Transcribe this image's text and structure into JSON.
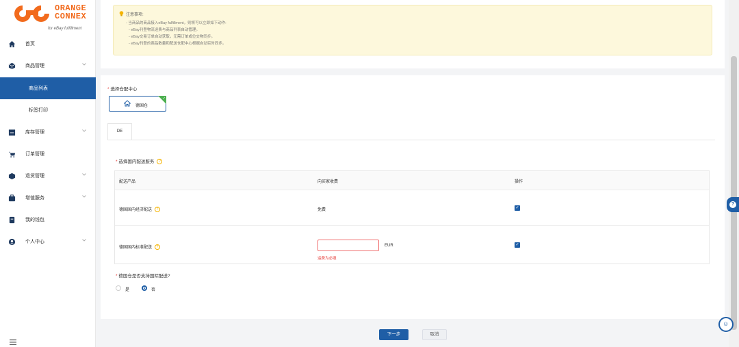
{
  "brand": {
    "logo_line1": "ORANGE",
    "logo_line2": "CONNEX",
    "tagline": "for eBay fulfillment",
    "accent": "#f26b1d"
  },
  "sidebar": {
    "items": [
      {
        "label": "首页",
        "icon": "home-icon"
      },
      {
        "label": "商品管理",
        "icon": "box-icon"
      },
      {
        "label": "商品列表",
        "icon": "",
        "active": true
      },
      {
        "label": "标签打印",
        "icon": ""
      },
      {
        "label": "库存管理",
        "icon": "warehouse-icon"
      },
      {
        "label": "订单管理",
        "icon": "cart-icon"
      },
      {
        "label": "退货管理",
        "icon": "return-icon"
      },
      {
        "label": "增值服务",
        "icon": "service-icon"
      },
      {
        "label": "我的钱包",
        "icon": "wallet-icon"
      },
      {
        "label": "个人中心",
        "icon": "user-icon"
      }
    ],
    "active_color": "#1f5ea6"
  },
  "notice": {
    "title": "注意事项:",
    "lines": [
      "- 当商品的商品接入eBay fulfillment，则将可以立即如下动作:",
      "- eBay刊登物流运费与商品列表自动管理。",
      "- eBay交易订单自动获取，无需订单或位交物同步。",
      "- eBay刊登的商品数量和配送仓配中心根据自动实时同步。"
    ]
  },
  "warehouse": {
    "section_label": "选择仓配中心",
    "selected": "德国仓"
  },
  "tabs": [
    "DE"
  ],
  "domestic": {
    "section_label": "选择国内配送服务",
    "columns": [
      "配送产品",
      "向买家收费",
      "操作"
    ],
    "rows": [
      {
        "product": "德国国内经济配送",
        "charge": "免费",
        "checked": true
      },
      {
        "product": "德国国内标准配送",
        "charge": "",
        "unit": "EUR",
        "error": "运费为必填",
        "checked": true
      }
    ]
  },
  "international": {
    "question": "德国仓是否支持国际配送?",
    "options": [
      "是",
      "否"
    ],
    "selected": "否"
  },
  "footer": {
    "next_label": "下一步",
    "cancel_label": "取消"
  }
}
